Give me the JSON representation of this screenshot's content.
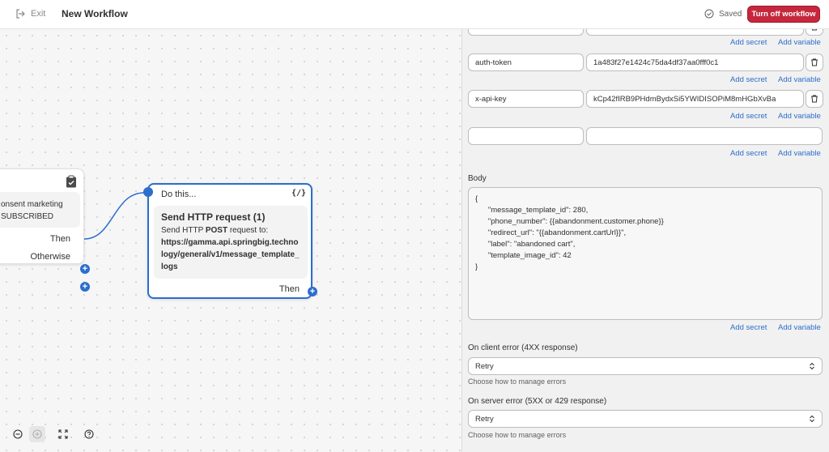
{
  "header": {
    "exit_label": "Exit",
    "title": "New Workflow",
    "saved_label": "Saved",
    "turn_off_label": "Turn off workflow"
  },
  "canvas": {
    "condition_node": {
      "line1": "onsent marketing",
      "line2": "SUBSCRIBED",
      "then_label": "Then",
      "otherwise_label": "Otherwise"
    },
    "action_node": {
      "label": "Do this...",
      "code_icon_text": "{/}",
      "title": "Send HTTP request (1)",
      "desc_prefix": "Send HTTP ",
      "method": "POST",
      "desc_suffix": " request to:",
      "url": "https://gamma.api.springbig.technology/general/v1/message_template_logs",
      "then_label": "Then"
    },
    "zoom": {
      "zoom_out": "−",
      "zoom_in": "+",
      "fit": "fit",
      "help": "?"
    }
  },
  "panel": {
    "headers": [
      {
        "key": "",
        "value": ""
      },
      {
        "key": "auth-token",
        "value": "1a483f27e1424c75da4df37aa0fff0c1"
      },
      {
        "key": "x-api-key",
        "value": "kCp42fIRB9PHdmBydxSi5YWIDISOPiM8mHGbXvBa"
      },
      {
        "key": "",
        "value": ""
      }
    ],
    "add_secret_label": "Add secret",
    "add_variable_label": "Add variable",
    "body_label": "Body",
    "body_value": "{\n      \"message_template_id\": 280,\n      \"phone_number\": {{abandonment.customer.phone}}\n      \"redirect_url\": \"{{abandonment.cartUrl}}\",\n      \"label\": \"abandoned cart\",\n      \"template_image_id\": 42\n}",
    "client_error": {
      "label": "On client error (4XX response)",
      "value": "Retry",
      "help": "Choose how to manage errors"
    },
    "server_error": {
      "label": "On server error (5XX or 429 response)",
      "value": "Retry",
      "help": "Choose how to manage errors"
    }
  },
  "colors": {
    "accent": "#2c6ecb",
    "danger": "#c5283d"
  }
}
